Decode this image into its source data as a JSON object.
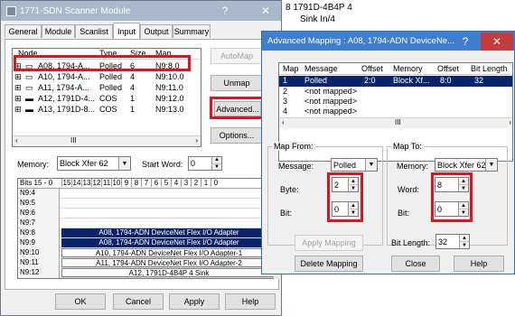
{
  "scanner": {
    "title": "1771-SDN Scanner Module",
    "help_icon": "?",
    "close_icon": "✕",
    "tabs": [
      "General",
      "Module",
      "Scanlist",
      "Input",
      "Output",
      "Summary"
    ],
    "active_tab": "Input",
    "list_headers": [
      "Node",
      "Type",
      "Size",
      "Map"
    ],
    "nodes": [
      {
        "name": "A08, 1794-A...",
        "type": "Polled",
        "size": "6",
        "map": "N9:8.0",
        "selected": true
      },
      {
        "name": "A10, 1794-A...",
        "type": "Polled",
        "size": "4",
        "map": "N9:10.0"
      },
      {
        "name": "A11, 1794-A...",
        "type": "Polled",
        "size": "4",
        "map": "N9:11.0"
      },
      {
        "name": "A12, 1791D-4...",
        "type": "COS",
        "size": "1",
        "map": "N9:12.0"
      },
      {
        "name": "A13, 1791D-8...",
        "type": "COS",
        "size": "1",
        "map": "N9:13.0"
      }
    ],
    "buttons": {
      "automap": "AutoMap",
      "unmap": "Unmap",
      "advanced": "Advanced...",
      "options": "Options..."
    },
    "memory_label": "Memory:",
    "memory_value": "Block Xfer 62",
    "start_word_label": "Start Word:",
    "start_word_value": "0",
    "bits_header": "Bits 15 - 0",
    "bit_numbers": [
      "15",
      "14",
      "13",
      "12",
      "11",
      "10",
      "9",
      "8",
      "7",
      "6",
      "5",
      "4",
      "3",
      "2",
      "1",
      "0"
    ],
    "word_rows": [
      {
        "word": "N9:4",
        "text": ""
      },
      {
        "word": "N9:5",
        "text": ""
      },
      {
        "word": "N9:6",
        "text": ""
      },
      {
        "word": "N9:7",
        "text": ""
      },
      {
        "word": "N9:8",
        "text": "A08, 1794-ADN DeviceNet Flex I/O Adapter",
        "highlight": true
      },
      {
        "word": "N9:9",
        "text": "A08, 1794-ADN DeviceNet Flex I/O Adapter",
        "highlight": true
      },
      {
        "word": "N9:10",
        "text": "A10, 1794-ADN DeviceNet Flex I/O Adapter-1"
      },
      {
        "word": "N9:11",
        "text": "A11, 1794-ADN DeviceNet Flex I/O Adapter-2"
      },
      {
        "word": "N9:12",
        "text": "A12, 1791D-4B4P 4 Sink"
      }
    ],
    "footer": {
      "ok": "OK",
      "cancel": "Cancel",
      "apply": "Apply",
      "help": "Help"
    }
  },
  "background_text": {
    "line1": "8    1791D-4B4P 4",
    "line2": "Sink In/4"
  },
  "advanced": {
    "title": "Advanced Mapping : A08, 1794-ADN DeviceNe...",
    "help_icon": "?",
    "close_icon": "✕",
    "headers": [
      "Map",
      "Message",
      "Offset",
      "Memory",
      "Offset",
      "Bit Length"
    ],
    "rows": [
      {
        "map": "1",
        "message": "Polled",
        "offset": "2:0",
        "memory": "Block Xf...",
        "offset2": "8:0",
        "bitlen": "32",
        "selected": true
      },
      {
        "map": "2",
        "message": "<not mapped>"
      },
      {
        "map": "3",
        "message": "<not mapped>"
      },
      {
        "map": "4",
        "message": "<not mapped>"
      }
    ],
    "map_from": {
      "title": "Map From:",
      "message_label": "Message:",
      "message_value": "Polled",
      "byte_label": "Byte:",
      "byte_value": "2",
      "bit_label": "Bit:",
      "bit_value": "0"
    },
    "map_to": {
      "title": "Map To:",
      "memory_label": "Memory:",
      "memory_value": "Block Xfer 62",
      "word_label": "Word:",
      "word_value": "8",
      "bit_label": "Bit:",
      "bit_value": "0"
    },
    "apply_mapping": "Apply Mapping",
    "bit_length_label": "Bit Length:",
    "bit_length_value": "32",
    "delete_mapping": "Delete Mapping",
    "close": "Close",
    "help": "Help"
  }
}
